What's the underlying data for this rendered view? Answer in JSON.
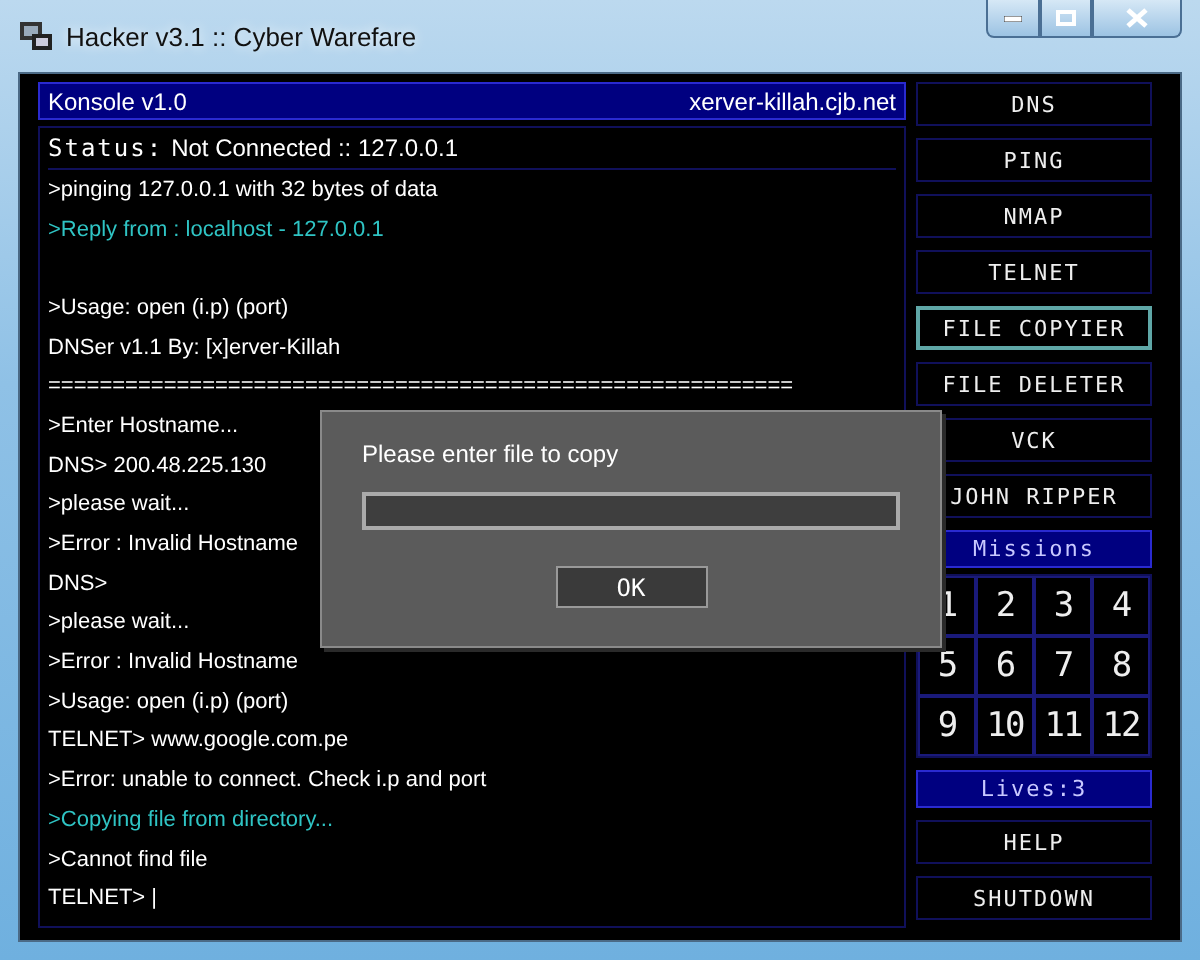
{
  "window": {
    "title": "Hacker v3.1 :: Cyber Warefare"
  },
  "console": {
    "title": "Konsole v1.0",
    "site": "xerver-killah.cjb.net",
    "status_label": "Status:",
    "status_value": "Not Connected :: 127.0.0.1",
    "lines": [
      {
        "kind": "plain",
        "text": ">pinging 127.0.0.1 with 32 bytes of data"
      },
      {
        "kind": "info",
        "text": ">Reply from : localhost - 127.0.0.1"
      },
      {
        "kind": "blank"
      },
      {
        "kind": "plain",
        "text": ">Usage: open (i.p) (port)"
      },
      {
        "kind": "plain",
        "text": "DNSer v1.1 By: [x]erver-Killah"
      },
      {
        "kind": "plain",
        "text": "=========================================================="
      },
      {
        "kind": "plain",
        "text": ">Enter Hostname..."
      },
      {
        "kind": "plain",
        "text": "DNS> 200.48.225.130"
      },
      {
        "kind": "plain",
        "text": ">please wait..."
      },
      {
        "kind": "plain",
        "text": ">Error : Invalid Hostname"
      },
      {
        "kind": "plain",
        "text": "DNS>"
      },
      {
        "kind": "plain",
        "text": ">please wait..."
      },
      {
        "kind": "plain",
        "text": ">Error : Invalid Hostname"
      },
      {
        "kind": "plain",
        "text": ">Usage: open (i.p) (port)"
      },
      {
        "kind": "plain",
        "text": "TELNET> www.google.com.pe"
      },
      {
        "kind": "plain",
        "text": ">Error: unable to connect. Check i.p and port"
      },
      {
        "kind": "info",
        "text": ">Copying file from directory..."
      },
      {
        "kind": "plain",
        "text": ">Cannot find file"
      },
      {
        "kind": "plain",
        "text": "TELNET> |"
      }
    ]
  },
  "sidebar": {
    "tools": [
      {
        "label": "DNS",
        "selected": false
      },
      {
        "label": "PING",
        "selected": false
      },
      {
        "label": "NMAP",
        "selected": false
      },
      {
        "label": "TELNET",
        "selected": false
      },
      {
        "label": "FILE COPYIER",
        "selected": true
      },
      {
        "label": "FILE DELETER",
        "selected": false
      },
      {
        "label": "VCK",
        "selected": false
      },
      {
        "label": "JOHN RIPPER",
        "selected": false
      }
    ],
    "missions_title": "Missions",
    "missions": [
      "1",
      "2",
      "3",
      "4",
      "5",
      "6",
      "7",
      "8",
      "9",
      "10",
      "11",
      "12"
    ],
    "lives": "Lives:3",
    "actions": [
      "HELP",
      "SHUTDOWN"
    ]
  },
  "dialog": {
    "message": "Please enter file to copy",
    "ok_label": "OK"
  }
}
